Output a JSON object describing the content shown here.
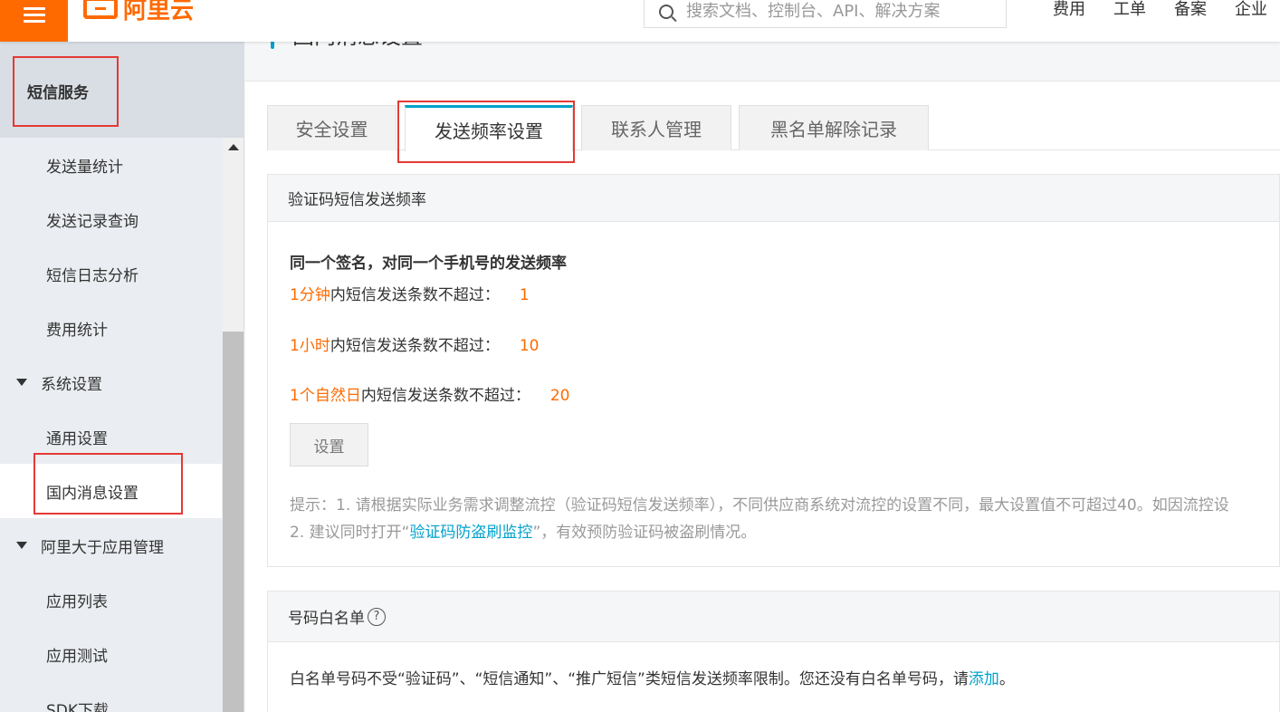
{
  "header": {
    "logo_text": "阿里云",
    "search_placeholder": "搜索文档、控制台、API、解决方案",
    "links": [
      "费用",
      "工单",
      "备案",
      "企业"
    ]
  },
  "sidebar": {
    "title": "短信服务",
    "items": [
      {
        "label": "发送量统计",
        "type": "item"
      },
      {
        "label": "发送记录查询",
        "type": "item"
      },
      {
        "label": "短信日志分析",
        "type": "item"
      },
      {
        "label": "费用统计",
        "type": "item"
      },
      {
        "label": "系统设置",
        "type": "group"
      },
      {
        "label": "通用设置",
        "type": "item"
      },
      {
        "label": "国内消息设置",
        "type": "item",
        "active": true
      },
      {
        "label": "阿里大于应用管理",
        "type": "group"
      },
      {
        "label": "应用列表",
        "type": "item"
      },
      {
        "label": "应用测试",
        "type": "item"
      },
      {
        "label": "SDK下载",
        "type": "item"
      }
    ]
  },
  "page": {
    "title": "国内消息设置"
  },
  "tabs": [
    {
      "label": "安全设置"
    },
    {
      "label": "发送频率设置",
      "active": true
    },
    {
      "label": "联系人管理"
    },
    {
      "label": "黑名单解除记录"
    }
  ],
  "rate_panel": {
    "header": "验证码短信发送频率",
    "rule_title": "同一个签名，对同一个手机号的发送频率",
    "rules": [
      {
        "period": "1分钟",
        "text": "内短信发送条数不超过：",
        "value": "1"
      },
      {
        "period": "1小时",
        "text": "内短信发送条数不超过：",
        "value": "10"
      },
      {
        "period": "1个自然日",
        "text": "内短信发送条数不超过：",
        "value": "20"
      }
    ],
    "set_button": "设置",
    "tip_line1": "提示：1. 请根据实际业务需求调整流控（验证码短信发送频率），不同供应商系统对流控的设置不同，最大设置值不可超过40。如因流控设",
    "tip_line2_prefix": "2. 建议同时打开“",
    "tip_line2_link": "验证码防盗刷监控",
    "tip_line2_suffix": "”，有效预防验证码被盗刷情况。"
  },
  "whitelist_panel": {
    "header": "号码白名单",
    "help_icon": "?",
    "text": "白名单号码不受“验证码”、“短信通知”、“推广短信”类短信发送频率限制。您还没有白名单号码，请",
    "link": "添加",
    "suffix": "。"
  }
}
